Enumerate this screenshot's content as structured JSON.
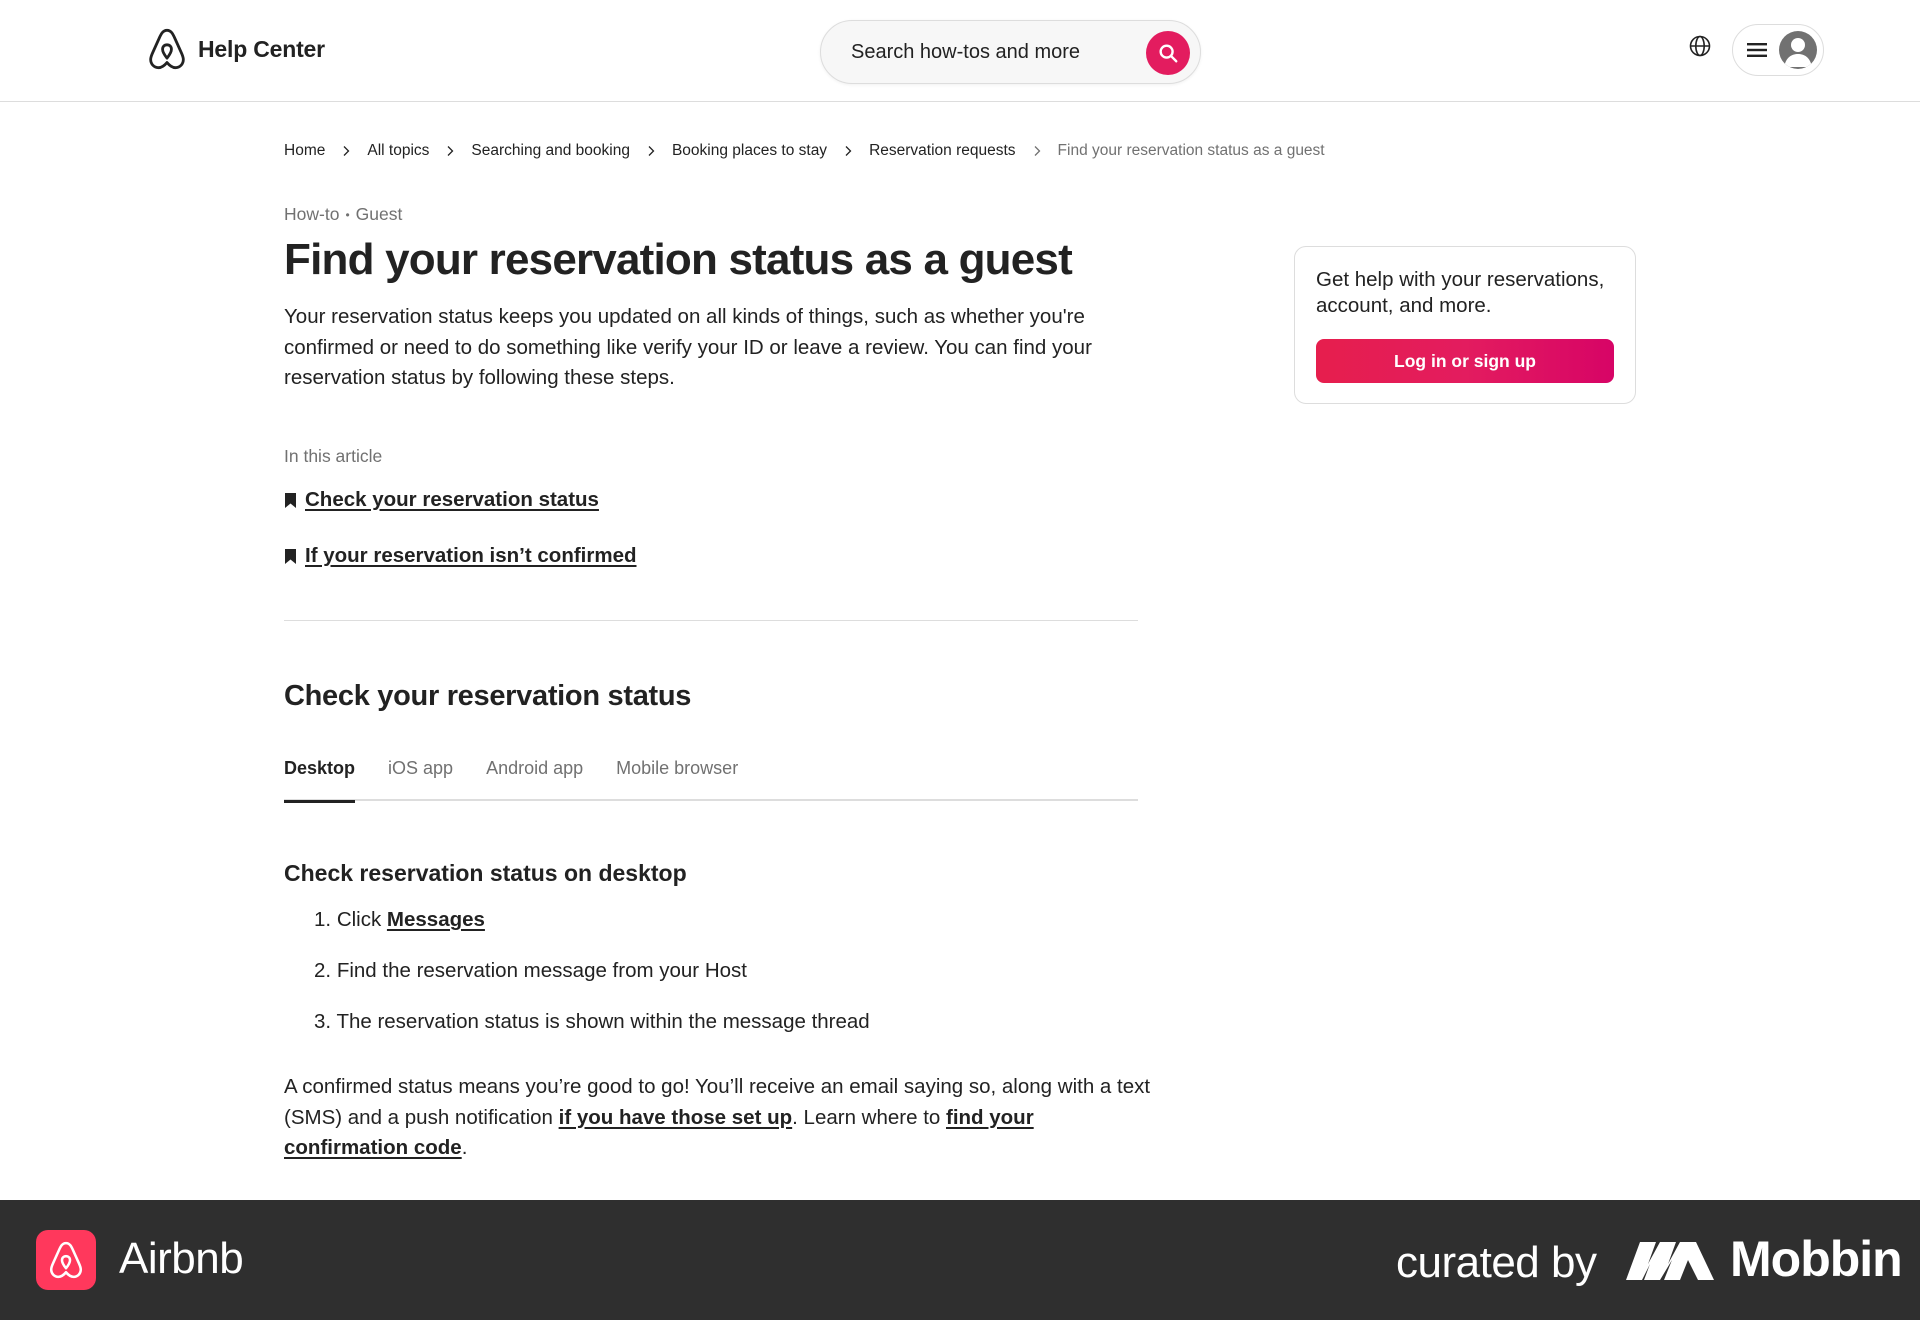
{
  "header": {
    "brand": "Help Center",
    "search_placeholder": "Search how-tos and more",
    "icons": {
      "logo": "airbnb-logo-icon",
      "search": "search-icon",
      "globe": "globe-icon",
      "menu": "hamburger-icon",
      "avatar": "user-avatar-icon"
    },
    "accent_color": "#e31c5f"
  },
  "breadcrumb": [
    "Home",
    "All topics",
    "Searching and booking",
    "Booking places to stay",
    "Reservation requests",
    "Find your reservation status as a guest"
  ],
  "article": {
    "type": "How-to",
    "audience": "Guest",
    "title": "Find your reservation status as a guest",
    "intro": "Your reservation status keeps you updated on all kinds of things, such as whether you're confirmed or need to do something like verify your ID or leave a review. You can find your reservation status by following these steps.",
    "toc_label": "In this article",
    "toc": [
      "Check your reservation status",
      "If your reservation isn’t confirmed"
    ],
    "section_title": "Check your reservation status",
    "tabs": [
      "Desktop",
      "iOS app",
      "Android app",
      "Mobile browser"
    ],
    "active_tab": "Desktop",
    "subsection_title": "Check reservation status on desktop",
    "steps": {
      "s1_num": "1.",
      "s1_text": "Click ",
      "s1_link": "Messages",
      "s2_num": "2.",
      "s2_text": "Find the reservation message from your Host",
      "s3_num": "3.",
      "s3_text": "The reservation status is shown within the message thread"
    },
    "outro": {
      "part1": "A confirmed status means you’re good to go! You’ll receive an email saying so, along with a text (SMS) and a push notification ",
      "link1": "if you have those set up",
      "part2": ". Learn where to ",
      "link2": "find your confirmation code",
      "part3": "."
    }
  },
  "sidebar": {
    "card_text": "Get help with your reservations, account, and more.",
    "button_label": "Log in or sign up"
  },
  "footer": {
    "app_name": "Airbnb",
    "curated_by": "curated by",
    "brand": "Mobbin",
    "logo_color": "#ff385c",
    "bg_color": "#2f2f2f"
  }
}
